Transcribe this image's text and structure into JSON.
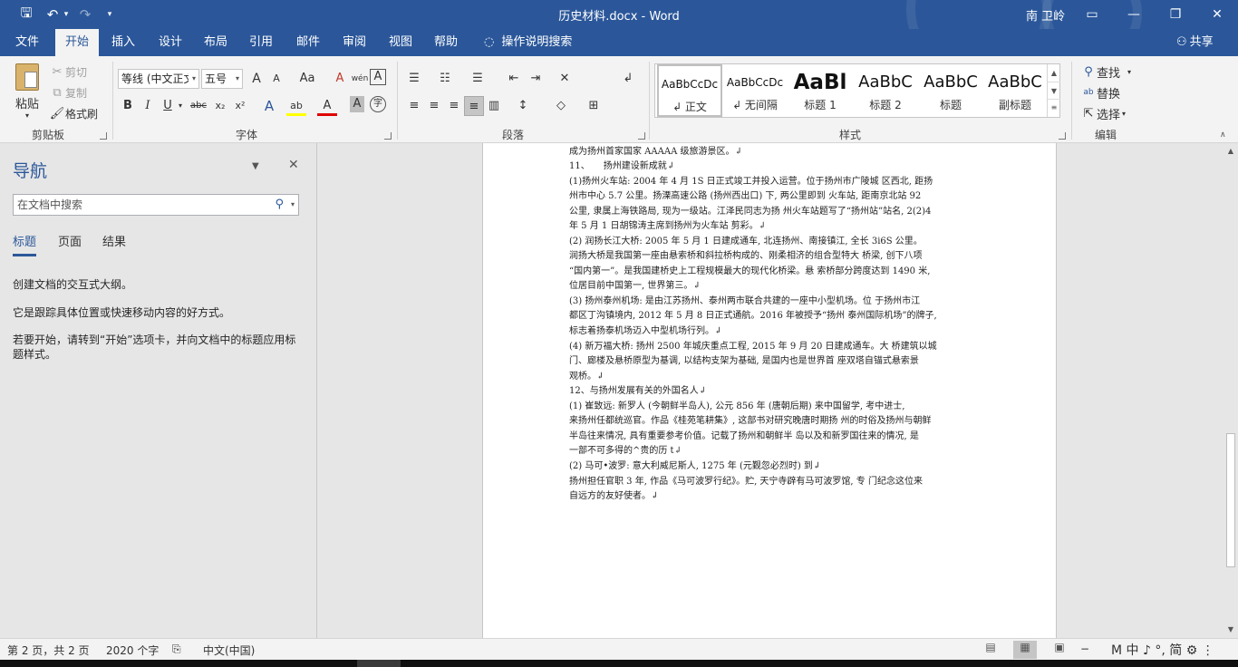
{
  "window": {
    "title": "历史材料.docx  -  Word",
    "user": "南 卫岭",
    "quick_access": {
      "save": "🖫",
      "undo": "↶",
      "undo_arrow": "▾",
      "redo": "↷",
      "customize": "▾"
    },
    "controls": {
      "restore_ribbon": "▭",
      "minimize": "—",
      "maximize": "❐",
      "close": "✕"
    }
  },
  "ribbon_tabs": [
    {
      "label": "文件"
    },
    {
      "label": "开始"
    },
    {
      "label": "插入"
    },
    {
      "label": "设计"
    },
    {
      "label": "布局"
    },
    {
      "label": "引用"
    },
    {
      "label": "邮件"
    },
    {
      "label": "审阅"
    },
    {
      "label": "视图"
    },
    {
      "label": "帮助"
    }
  ],
  "tell_me": {
    "icon": "lightbulb-icon",
    "label": "操作说明搜索"
  },
  "share": {
    "icon": "person-icon",
    "label": "共享"
  },
  "groups": {
    "clipboard": {
      "label": "剪贴板",
      "paste": "粘贴",
      "cut": "剪切",
      "copy": "复制",
      "format_painter": "格式刷"
    },
    "font": {
      "label": "字体",
      "font_name": "等线 (中文正文)",
      "font_size": "五号",
      "grow": "A",
      "shrink": "A",
      "change_case": "Aa",
      "clear": "A",
      "phonetic": "wén",
      "border": "A",
      "bold": "B",
      "italic": "I",
      "underline": "U",
      "strike": "abc",
      "sub": "x₂",
      "sup": "x²",
      "effects": "A",
      "highlight": "ab",
      "color": "A",
      "shading": "A",
      "enclose": "字"
    },
    "paragraph": {
      "label": "段落"
    },
    "styles": {
      "label": "样式",
      "items": [
        {
          "sample": "AaBbCcDc",
          "name": "↲ 正文"
        },
        {
          "sample": "AaBbCcDc",
          "name": "↲ 无间隔"
        },
        {
          "sample": "AaBl",
          "name": "标题 1"
        },
        {
          "sample": "AaBbC",
          "name": "标题 2"
        },
        {
          "sample": "AaBbC",
          "name": "标题"
        },
        {
          "sample": "AaBbC",
          "name": "副标题"
        }
      ]
    },
    "editing": {
      "label": "编辑",
      "find": "查找",
      "replace": "替换",
      "select": "选择"
    }
  },
  "nav": {
    "title": "导航",
    "search_placeholder": "在文档中搜索",
    "tabs": [
      {
        "label": "标题"
      },
      {
        "label": "页面"
      },
      {
        "label": "结果"
      }
    ],
    "hints": [
      "创建文档的交互式大纲。",
      "它是跟踪具体位置或快速移动内容的好方式。",
      "若要开始，请转到“开始”选项卡，并向文档中的标题应用标题样式。"
    ]
  },
  "doc_lines": [
    "成为扬州首家国家 AAAAA 级旅游景区。↲",
    "11、　　扬州建设新成就↲",
    "(1)扬州火车站: 2004 年 4 月 1S 日正式竣工并投入运营。位于扬州市广陵城  区西北, 距扬",
    "州市中心 5.7 公里。扬溧高速公路 (扬州西出口) 下, 两公里即到  火车站, 距南京北站 92",
    "公里, 隶属上海铁路局, 现为一级站。江泽民同志为扬  州火车站题写了“扬州站”站名, 2(2)4",
    "年 5 月 1 日胡锦涛主席到扬州为火车站  剪彩。↲",
    "(2)  润扬长江大桥:   2005 年 5 月 1 日建成通车, 北连扬州、南接镇江, 全长 3i6S 公里。",
    "润扬大桥是我国第一座由悬索桥和斜拉桥构成的、刚柔相济的组合型特大  桥梁, 创下八项",
    "“国内第一”。是我国建桥史上工程规模最大的现代化桥梁。悬  索桥部分跨度达到 1490 米,",
    "位居目前中国第一, 世界第三。↲",
    "(3)  扬州泰州机场: 是由江苏扬州、泰州两市联合共建的一座中小型机场。位  于扬州市江",
    "都区丁沟镇境内, 2012 年 5 月 8 日正式通航。2016 年被授予“扬州  泰州国际机场”的牌子,",
    "标志着扬泰机场迈入中型机场行列。↲",
    "(4)  新万福大桥: 扬州 2500 年城庆重点工程, 2015 年 9 月 20 日建成通车。大  桥建筑以城",
    "门、廊楼及悬桥原型为基调, 以结构支架为基础, 是国内也是世界首  座双塔自锚式悬索景",
    "观桥。↲",
    "12、与扬州发展有关的外国名人↲",
    "(1) 崔致远: 新罗人 (今朝鲜半岛人), 公元 856 年 (唐朝后期) 来中国留学,   考中进士,",
    "来扬州任都统巡官。作品《桂苑笔耕集》, 这部书对研究晚唐时期扬  州的时俗及扬州与朝鲜",
    "半岛往来情况, 具有重要参考价值。记载了扬州和朝鲜半  岛以及和新罗国往来的情况, 是",
    "一部不可多得的^贵的历 t↲",
    "(2)   马可•波罗: 意大利威尼斯人, 1275 年 (元觐忽必烈时) 到↲",
    "扬州担任官职 3 年, 作品《马可波罗行纪》。贮, 天宁寺辟有马可波罗馆, 专  门纪念这位来",
    "自远方的友好使者。↲"
  ],
  "status": {
    "page": "第 2 页，共 2 页",
    "words": "2020 个字",
    "proofing_icon": "proofing-icon",
    "language": "中文(中国)",
    "zoom_minus": "−",
    "ime": "M 中 ♪ °, 简 ⚙ ⋮"
  }
}
